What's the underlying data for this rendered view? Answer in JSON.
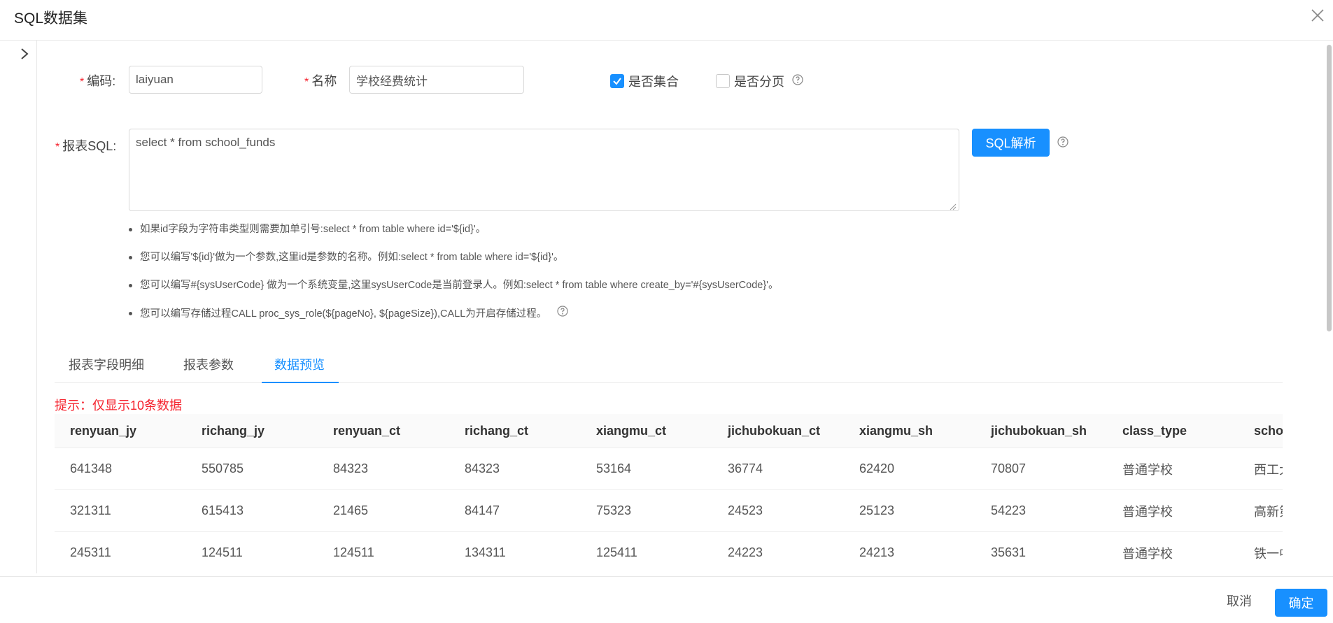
{
  "header": {
    "title": "SQL数据集"
  },
  "form": {
    "code_label": "编码:",
    "code_value": "laiyuan",
    "name_label": "名称",
    "name_value": "学校经费统计",
    "is_collection_label": "是否集合",
    "is_collection_checked": true,
    "is_paged_label": "是否分页",
    "is_paged_checked": false,
    "sql_label": "报表SQL:",
    "sql_value": "select * from school_funds",
    "parse_button": "SQL解析"
  },
  "tips": [
    "如果id字段为字符串类型则需要加单引号:select * from table where id='${id}'。",
    "您可以编写'${id}'做为一个参数,这里id是参数的名称。例如:select * from table where id='${id}'。",
    "您可以编写#{sysUserCode} 做为一个系统变量,这里sysUserCode是当前登录人。例如:select * from table where create_by='#{sysUserCode}'。",
    "您可以编写存储过程CALL proc_sys_role(${pageNo}, ${pageSize}),CALL为开启存储过程。"
  ],
  "tabs": [
    "报表字段明细",
    "报表参数",
    "数据预览"
  ],
  "active_tab": "数据预览",
  "notice": "提示：仅显示10条数据",
  "table": {
    "columns": [
      "renyuan_jy",
      "richang_jy",
      "renyuan_ct",
      "richang_ct",
      "xiangmu_ct",
      "jichubokuan_ct",
      "xiangmu_sh",
      "jichubokuan_sh",
      "class_type",
      "school_name"
    ],
    "rows": [
      [
        "641348",
        "550785",
        "84323",
        "84323",
        "53164",
        "36774",
        "62420",
        "70807",
        "普通学校",
        "西工大附中"
      ],
      [
        "321311",
        "615413",
        "21465",
        "84147",
        "75323",
        "24523",
        "25123",
        "54223",
        "普通学校",
        "高新第一中学"
      ],
      [
        "245311",
        "124511",
        "124511",
        "134311",
        "125411",
        "24223",
        "24213",
        "35631",
        "普通学校",
        "铁一中学"
      ]
    ]
  },
  "footer": {
    "cancel": "取消",
    "confirm": "确定"
  },
  "colors": {
    "primary": "#1890ff",
    "required": "#f5222d"
  },
  "icons": [
    "close-icon",
    "chevron-right-icon",
    "checkmark-icon",
    "question-circle-icon",
    "resize-handle-icon"
  ]
}
